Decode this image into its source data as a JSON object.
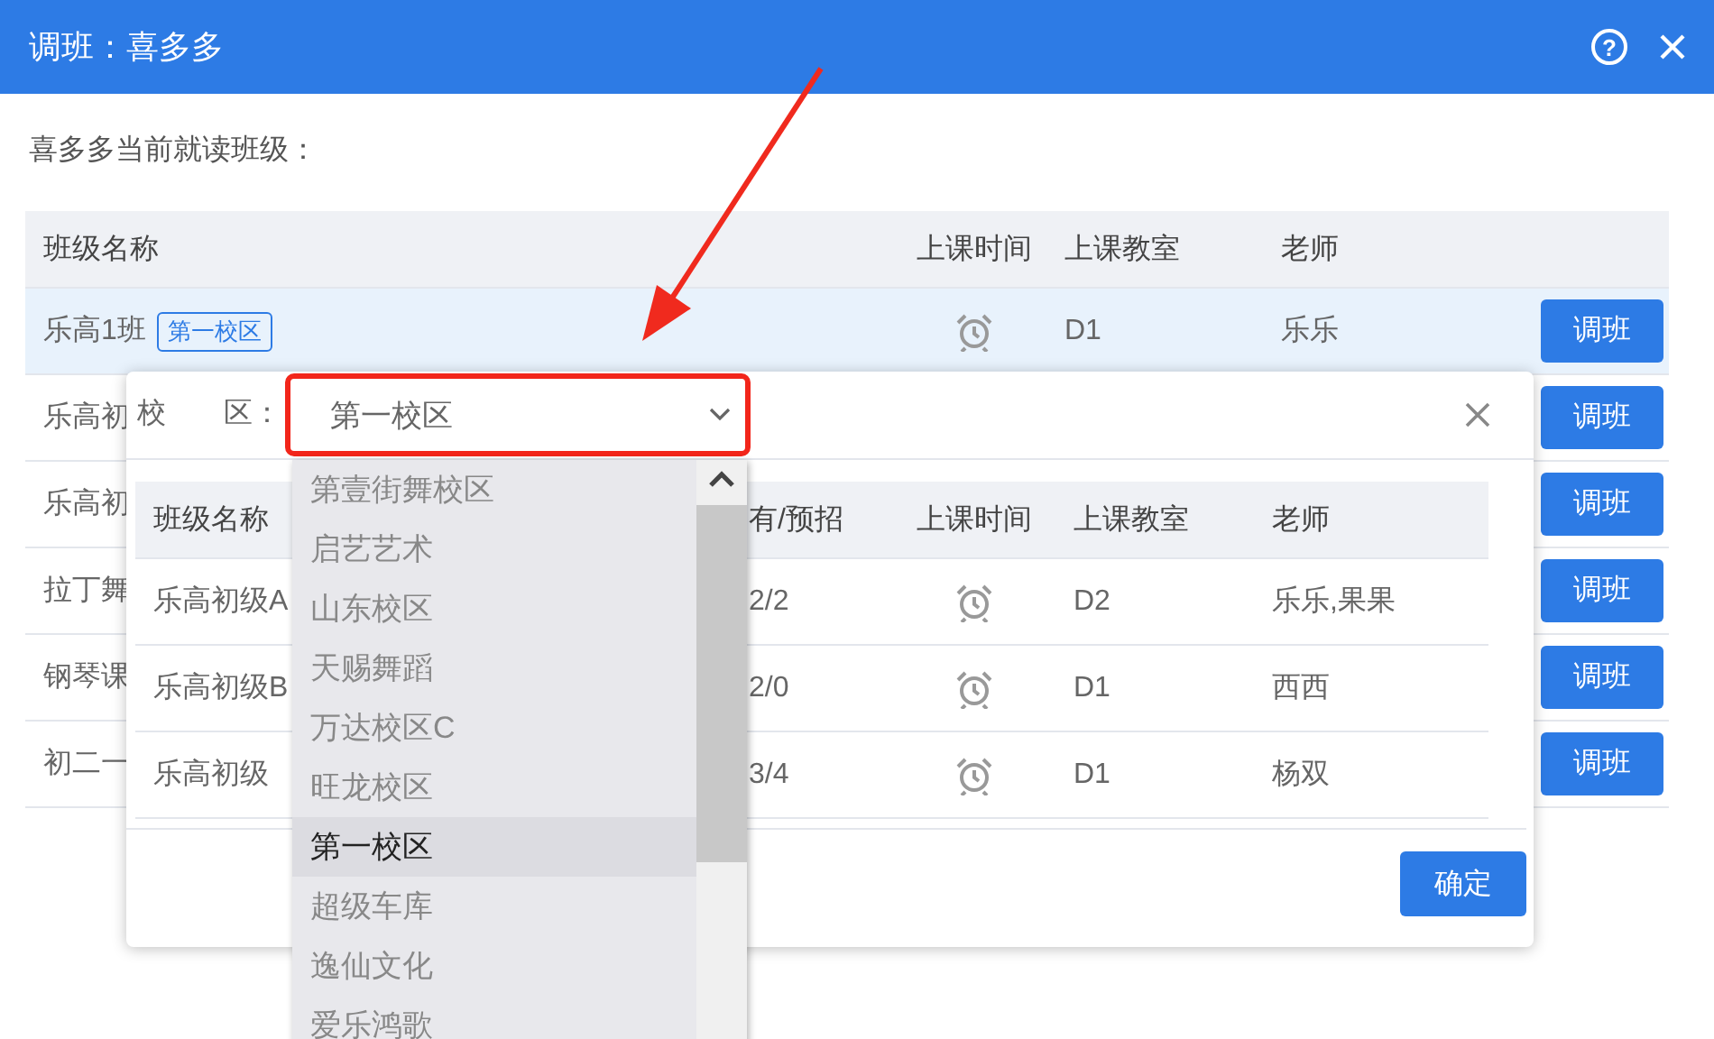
{
  "dialog": {
    "title": "调班：喜多多",
    "help": "?"
  },
  "current_label": "喜多多当前就读班级：",
  "table": {
    "columns": [
      "班级名称",
      "上课时间",
      "上课教室",
      "老师"
    ],
    "rows": [
      {
        "name": "乐高1班",
        "tag": "第一校区",
        "classroom": "D1",
        "teacher": "乐乐",
        "button": "调班",
        "selected": true
      },
      {
        "name": "乐高初",
        "button": "调班",
        "selected": false
      },
      {
        "name": "乐高初",
        "button": "调班",
        "selected": false
      },
      {
        "name": "拉丁舞",
        "button": "调班",
        "selected": false
      },
      {
        "name": "钢琴课",
        "button": "调班",
        "selected": false
      },
      {
        "name": "初二一",
        "button": "调班",
        "selected": false
      }
    ]
  },
  "popup": {
    "label": "校　　区：",
    "select_value": "第一校区",
    "options": [
      {
        "label": "第壹街舞校区",
        "selected": false
      },
      {
        "label": "启艺艺术",
        "selected": false
      },
      {
        "label": "山东校区",
        "selected": false
      },
      {
        "label": "天赐舞蹈",
        "selected": false
      },
      {
        "label": "万达校区C",
        "selected": false
      },
      {
        "label": "旺龙校区",
        "selected": false
      },
      {
        "label": "第一校区",
        "selected": true
      },
      {
        "label": "超级车库",
        "selected": false
      },
      {
        "label": "逸仙文化",
        "selected": false
      },
      {
        "label": "爱乐鸿歌",
        "selected": false
      }
    ],
    "columns": [
      "班级名称",
      "有/预招",
      "上课时间",
      "上课教室",
      "老师"
    ],
    "rows": [
      {
        "name": "乐高初级A",
        "count": "2/2",
        "classroom": "D2",
        "teacher": "乐乐,果果"
      },
      {
        "name": "乐高初级B",
        "count": "2/0",
        "classroom": "D1",
        "teacher": "西西"
      },
      {
        "name": "乐高初级",
        "count": "3/4",
        "classroom": "D1",
        "teacher": "杨双"
      }
    ],
    "confirm": "确定"
  }
}
